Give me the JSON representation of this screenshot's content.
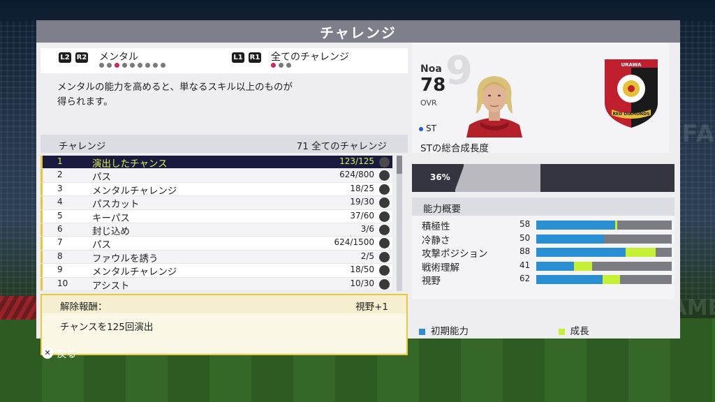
{
  "title": "チャレンジ",
  "nav": {
    "left_btns": [
      "L2",
      "R2"
    ],
    "left_label": "メンタル",
    "left_dots_total": 9,
    "left_dots_active": 3,
    "right_btns": [
      "L1",
      "R1"
    ],
    "right_label": "全てのチャレンジ",
    "right_dots_total": 3,
    "right_dots_active": 1
  },
  "description": [
    "メンタルの能力を高めると、単なるスキル以上のものが",
    "得られます。"
  ],
  "list_header": {
    "left": "チャレンジ",
    "right": "71 全てのチャレンジ"
  },
  "challenges": [
    {
      "num": "1",
      "name": "演出したチャンス",
      "progress": "123/125"
    },
    {
      "num": "2",
      "name": "パス",
      "progress": "624/800"
    },
    {
      "num": "3",
      "name": "メンタルチャレンジ",
      "progress": "18/25"
    },
    {
      "num": "4",
      "name": "パスカット",
      "progress": "19/30"
    },
    {
      "num": "5",
      "name": "キーパス",
      "progress": "37/60"
    },
    {
      "num": "6",
      "name": "封じ込め",
      "progress": "3/6"
    },
    {
      "num": "7",
      "name": "パス",
      "progress": "624/1500"
    },
    {
      "num": "8",
      "name": "ファウルを誘う",
      "progress": "2/5"
    },
    {
      "num": "9",
      "name": "メンタルチャレンジ",
      "progress": "18/50"
    },
    {
      "num": "10",
      "name": "アシスト",
      "progress": "10/30"
    }
  ],
  "selected_index": 0,
  "reward": {
    "label": "解除報酬：",
    "value": "視野+1",
    "body": "チャンスを125回演出"
  },
  "player": {
    "name": "Noa",
    "ovr": "78",
    "ovr_label": "OVR",
    "position": "ST",
    "growth_label": "STの総合成長度",
    "bg_number": "9",
    "crest_text": "RED DIAMONDS",
    "crest_top": "URAWA"
  },
  "growth": {
    "percent_text": "36%",
    "percent": 36
  },
  "attributes_header": "能力概要",
  "attributes": [
    {
      "name": "積極性",
      "value": "58",
      "base": 58,
      "gain": 2
    },
    {
      "name": "冷静さ",
      "value": "50",
      "base": 50,
      "gain": 0
    },
    {
      "name": "攻撃ポジション",
      "value": "88",
      "base": 66,
      "gain": 22
    },
    {
      "name": "戦術理解",
      "value": "41",
      "base": 28,
      "gain": 13
    },
    {
      "name": "視野",
      "value": "62",
      "base": 49,
      "gain": 13
    }
  ],
  "legend": {
    "base": "初期能力",
    "growth": "成長"
  },
  "colors": {
    "base": "#2a8fd2",
    "growth": "#c6f034",
    "accent": "#d0245e",
    "gold": "#ecc93a"
  },
  "back": {
    "button": "✕",
    "label": "戻る"
  },
  "watermarks": {
    "right": "FIFA",
    "bottom": "IT'S IN THE GAME"
  }
}
